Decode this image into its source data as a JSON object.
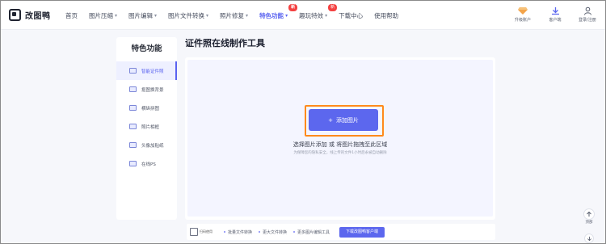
{
  "brand": {
    "name": "改图鸭"
  },
  "nav": {
    "items": [
      {
        "label": "首页",
        "has_chevron": false
      },
      {
        "label": "图片压缩",
        "has_chevron": true
      },
      {
        "label": "图片编辑",
        "has_chevron": true
      },
      {
        "label": "图片文件转换",
        "has_chevron": true
      },
      {
        "label": "照片修复",
        "has_chevron": true
      },
      {
        "label": "特色功能",
        "has_chevron": true,
        "active": true,
        "badge": "新"
      },
      {
        "label": "趣玩特效",
        "has_chevron": true,
        "badge": "新"
      },
      {
        "label": "下载中心",
        "has_chevron": false
      },
      {
        "label": "使用帮助",
        "has_chevron": false
      }
    ]
  },
  "header_actions": {
    "upgrade": {
      "label": "升级账户",
      "icon": "diamond-icon"
    },
    "client": {
      "label": "客户端",
      "icon": "download-icon"
    },
    "login": {
      "label": "登录/注册",
      "icon": "user-icon"
    }
  },
  "sidebar": {
    "title": "特色功能",
    "items": [
      {
        "label": "智能证件照",
        "active": true
      },
      {
        "label": "抠图换背景"
      },
      {
        "label": "横纵拼图"
      },
      {
        "label": "照片相框"
      },
      {
        "label": "头像加贴纸"
      },
      {
        "label": "在线PS"
      }
    ]
  },
  "main": {
    "title": "证件照在线制作工具",
    "upload": {
      "button_label": "添加图片",
      "hint": "选择图片添加 或 将图片拖拽至此区域",
      "sub_hint": "为保障您的隐私安全，线上传的文件1小时后永被自动删除"
    }
  },
  "footer": {
    "qr_label": "扫码使用",
    "links": [
      "批量文件转换",
      "更大文件转换",
      "更多图片编辑工具"
    ],
    "download_button": "下载改图鸭客户端"
  },
  "floating": {
    "top_label": "顶部"
  },
  "colors": {
    "accent": "#5c67ee",
    "highlight": "#ff8a1c",
    "badge": "#f44141"
  }
}
